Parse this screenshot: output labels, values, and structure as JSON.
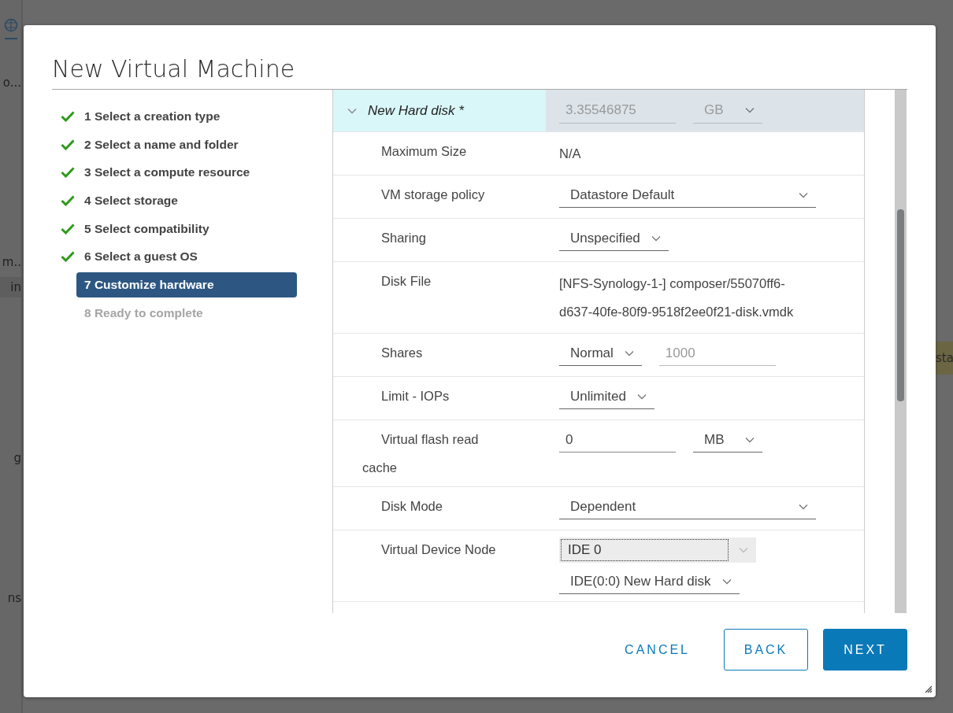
{
  "background": {
    "fragments": [
      "o...",
      "m..",
      "in",
      "g",
      "ns"
    ],
    "right_fragment": "sta"
  },
  "dialog": {
    "title": "New Virtual Machine",
    "steps": [
      {
        "label": "1 Select a creation type",
        "done": true,
        "selected": false,
        "disabled": false
      },
      {
        "label": "2 Select a name and folder",
        "done": true,
        "selected": false,
        "disabled": false
      },
      {
        "label": "3 Select a compute resource",
        "done": true,
        "selected": false,
        "disabled": false
      },
      {
        "label": "4 Select storage",
        "done": true,
        "selected": false,
        "disabled": false
      },
      {
        "label": "5 Select compatibility",
        "done": true,
        "selected": false,
        "disabled": false
      },
      {
        "label": "6 Select a guest OS",
        "done": true,
        "selected": false,
        "disabled": false
      },
      {
        "label": "7 Customize hardware",
        "done": false,
        "selected": true,
        "disabled": false
      },
      {
        "label": "8 Ready to complete",
        "done": false,
        "selected": false,
        "disabled": true
      }
    ],
    "device": {
      "title": "New Hard disk *",
      "expanded": true,
      "controls": [
        {
          "kind": "input",
          "value": "3.35546875",
          "disabled": true
        },
        {
          "kind": "select",
          "value": "GB",
          "disabled": true
        }
      ]
    },
    "rows": [
      {
        "label": "Maximum Size",
        "kind": "text",
        "value": "N/A"
      },
      {
        "label": "VM storage policy",
        "kind": "controls",
        "lines": [
          [
            {
              "kind": "wide-select",
              "value": "Datastore Default"
            }
          ]
        ]
      },
      {
        "label": "Sharing",
        "kind": "controls",
        "lines": [
          [
            {
              "kind": "select",
              "value": "Unspecified"
            }
          ]
        ]
      },
      {
        "label": "Disk File",
        "kind": "text",
        "value": "[NFS-Synology-1-] composer/55070ff6-d637-40fe-80f9-9518f2ee0f21-disk.vmdk"
      },
      {
        "label": "Shares",
        "kind": "controls",
        "lines": [
          [
            {
              "kind": "select",
              "value": "Normal"
            },
            {
              "kind": "input",
              "value": "1000",
              "disabled": true
            }
          ]
        ]
      },
      {
        "label": "Limit - IOPs",
        "kind": "controls",
        "lines": [
          [
            {
              "kind": "select",
              "value": "Unlimited"
            }
          ]
        ]
      },
      {
        "label": "Virtual flash read cache",
        "kind": "controls",
        "lines": [
          [
            {
              "kind": "input",
              "value": "0"
            },
            {
              "kind": "select",
              "value": "MB"
            }
          ]
        ]
      },
      {
        "label": "Disk Mode",
        "kind": "controls",
        "lines": [
          [
            {
              "kind": "wide-select",
              "value": "Dependent"
            }
          ]
        ]
      },
      {
        "label": "Virtual Device Node",
        "kind": "controls",
        "lines": [
          [
            {
              "kind": "select",
              "value": "IDE 0",
              "focused": true
            }
          ],
          [
            {
              "kind": "select",
              "value": "IDE(0:0) New Hard disk"
            }
          ]
        ]
      }
    ],
    "buttons": [
      {
        "label": "CANCEL",
        "kind": "flat"
      },
      {
        "label": "BACK",
        "kind": "outline"
      },
      {
        "label": "NEXT",
        "kind": "primary"
      }
    ]
  }
}
